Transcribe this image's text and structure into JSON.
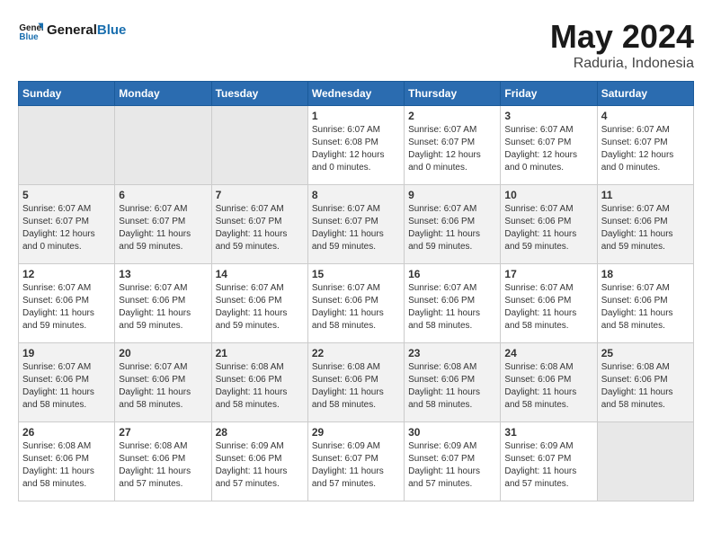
{
  "logo": {
    "text_general": "General",
    "text_blue": "Blue"
  },
  "title": "May 2024",
  "subtitle": "Raduria, Indonesia",
  "days_of_week": [
    "Sunday",
    "Monday",
    "Tuesday",
    "Wednesday",
    "Thursday",
    "Friday",
    "Saturday"
  ],
  "weeks": [
    [
      {
        "day": "",
        "empty": true
      },
      {
        "day": "",
        "empty": true
      },
      {
        "day": "",
        "empty": true
      },
      {
        "day": "1",
        "sunrise": "Sunrise: 6:07 AM",
        "sunset": "Sunset: 6:08 PM",
        "daylight": "Daylight: 12 hours and 0 minutes."
      },
      {
        "day": "2",
        "sunrise": "Sunrise: 6:07 AM",
        "sunset": "Sunset: 6:07 PM",
        "daylight": "Daylight: 12 hours and 0 minutes."
      },
      {
        "day": "3",
        "sunrise": "Sunrise: 6:07 AM",
        "sunset": "Sunset: 6:07 PM",
        "daylight": "Daylight: 12 hours and 0 minutes."
      },
      {
        "day": "4",
        "sunrise": "Sunrise: 6:07 AM",
        "sunset": "Sunset: 6:07 PM",
        "daylight": "Daylight: 12 hours and 0 minutes."
      }
    ],
    [
      {
        "day": "5",
        "sunrise": "Sunrise: 6:07 AM",
        "sunset": "Sunset: 6:07 PM",
        "daylight": "Daylight: 12 hours and 0 minutes."
      },
      {
        "day": "6",
        "sunrise": "Sunrise: 6:07 AM",
        "sunset": "Sunset: 6:07 PM",
        "daylight": "Daylight: 11 hours and 59 minutes."
      },
      {
        "day": "7",
        "sunrise": "Sunrise: 6:07 AM",
        "sunset": "Sunset: 6:07 PM",
        "daylight": "Daylight: 11 hours and 59 minutes."
      },
      {
        "day": "8",
        "sunrise": "Sunrise: 6:07 AM",
        "sunset": "Sunset: 6:07 PM",
        "daylight": "Daylight: 11 hours and 59 minutes."
      },
      {
        "day": "9",
        "sunrise": "Sunrise: 6:07 AM",
        "sunset": "Sunset: 6:06 PM",
        "daylight": "Daylight: 11 hours and 59 minutes."
      },
      {
        "day": "10",
        "sunrise": "Sunrise: 6:07 AM",
        "sunset": "Sunset: 6:06 PM",
        "daylight": "Daylight: 11 hours and 59 minutes."
      },
      {
        "day": "11",
        "sunrise": "Sunrise: 6:07 AM",
        "sunset": "Sunset: 6:06 PM",
        "daylight": "Daylight: 11 hours and 59 minutes."
      }
    ],
    [
      {
        "day": "12",
        "sunrise": "Sunrise: 6:07 AM",
        "sunset": "Sunset: 6:06 PM",
        "daylight": "Daylight: 11 hours and 59 minutes."
      },
      {
        "day": "13",
        "sunrise": "Sunrise: 6:07 AM",
        "sunset": "Sunset: 6:06 PM",
        "daylight": "Daylight: 11 hours and 59 minutes."
      },
      {
        "day": "14",
        "sunrise": "Sunrise: 6:07 AM",
        "sunset": "Sunset: 6:06 PM",
        "daylight": "Daylight: 11 hours and 59 minutes."
      },
      {
        "day": "15",
        "sunrise": "Sunrise: 6:07 AM",
        "sunset": "Sunset: 6:06 PM",
        "daylight": "Daylight: 11 hours and 58 minutes."
      },
      {
        "day": "16",
        "sunrise": "Sunrise: 6:07 AM",
        "sunset": "Sunset: 6:06 PM",
        "daylight": "Daylight: 11 hours and 58 minutes."
      },
      {
        "day": "17",
        "sunrise": "Sunrise: 6:07 AM",
        "sunset": "Sunset: 6:06 PM",
        "daylight": "Daylight: 11 hours and 58 minutes."
      },
      {
        "day": "18",
        "sunrise": "Sunrise: 6:07 AM",
        "sunset": "Sunset: 6:06 PM",
        "daylight": "Daylight: 11 hours and 58 minutes."
      }
    ],
    [
      {
        "day": "19",
        "sunrise": "Sunrise: 6:07 AM",
        "sunset": "Sunset: 6:06 PM",
        "daylight": "Daylight: 11 hours and 58 minutes."
      },
      {
        "day": "20",
        "sunrise": "Sunrise: 6:07 AM",
        "sunset": "Sunset: 6:06 PM",
        "daylight": "Daylight: 11 hours and 58 minutes."
      },
      {
        "day": "21",
        "sunrise": "Sunrise: 6:08 AM",
        "sunset": "Sunset: 6:06 PM",
        "daylight": "Daylight: 11 hours and 58 minutes."
      },
      {
        "day": "22",
        "sunrise": "Sunrise: 6:08 AM",
        "sunset": "Sunset: 6:06 PM",
        "daylight": "Daylight: 11 hours and 58 minutes."
      },
      {
        "day": "23",
        "sunrise": "Sunrise: 6:08 AM",
        "sunset": "Sunset: 6:06 PM",
        "daylight": "Daylight: 11 hours and 58 minutes."
      },
      {
        "day": "24",
        "sunrise": "Sunrise: 6:08 AM",
        "sunset": "Sunset: 6:06 PM",
        "daylight": "Daylight: 11 hours and 58 minutes."
      },
      {
        "day": "25",
        "sunrise": "Sunrise: 6:08 AM",
        "sunset": "Sunset: 6:06 PM",
        "daylight": "Daylight: 11 hours and 58 minutes."
      }
    ],
    [
      {
        "day": "26",
        "sunrise": "Sunrise: 6:08 AM",
        "sunset": "Sunset: 6:06 PM",
        "daylight": "Daylight: 11 hours and 58 minutes."
      },
      {
        "day": "27",
        "sunrise": "Sunrise: 6:08 AM",
        "sunset": "Sunset: 6:06 PM",
        "daylight": "Daylight: 11 hours and 57 minutes."
      },
      {
        "day": "28",
        "sunrise": "Sunrise: 6:09 AM",
        "sunset": "Sunset: 6:06 PM",
        "daylight": "Daylight: 11 hours and 57 minutes."
      },
      {
        "day": "29",
        "sunrise": "Sunrise: 6:09 AM",
        "sunset": "Sunset: 6:07 PM",
        "daylight": "Daylight: 11 hours and 57 minutes."
      },
      {
        "day": "30",
        "sunrise": "Sunrise: 6:09 AM",
        "sunset": "Sunset: 6:07 PM",
        "daylight": "Daylight: 11 hours and 57 minutes."
      },
      {
        "day": "31",
        "sunrise": "Sunrise: 6:09 AM",
        "sunset": "Sunset: 6:07 PM",
        "daylight": "Daylight: 11 hours and 57 minutes."
      },
      {
        "day": "",
        "empty": true
      }
    ]
  ]
}
